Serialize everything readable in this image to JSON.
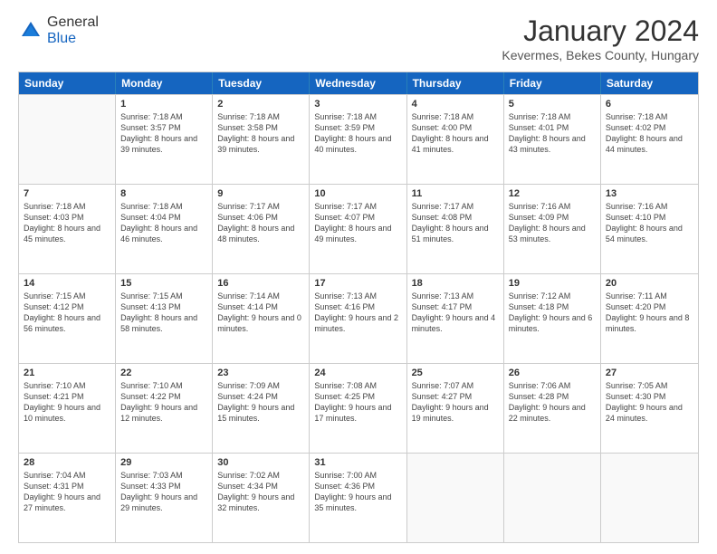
{
  "logo": {
    "general": "General",
    "blue": "Blue"
  },
  "header": {
    "title": "January 2024",
    "subtitle": "Kevermes, Bekes County, Hungary"
  },
  "days": [
    "Sunday",
    "Monday",
    "Tuesday",
    "Wednesday",
    "Thursday",
    "Friday",
    "Saturday"
  ],
  "weeks": [
    [
      {
        "date": "",
        "sunrise": "",
        "sunset": "",
        "daylight": ""
      },
      {
        "date": "1",
        "sunrise": "Sunrise: 7:18 AM",
        "sunset": "Sunset: 3:57 PM",
        "daylight": "Daylight: 8 hours and 39 minutes."
      },
      {
        "date": "2",
        "sunrise": "Sunrise: 7:18 AM",
        "sunset": "Sunset: 3:58 PM",
        "daylight": "Daylight: 8 hours and 39 minutes."
      },
      {
        "date": "3",
        "sunrise": "Sunrise: 7:18 AM",
        "sunset": "Sunset: 3:59 PM",
        "daylight": "Daylight: 8 hours and 40 minutes."
      },
      {
        "date": "4",
        "sunrise": "Sunrise: 7:18 AM",
        "sunset": "Sunset: 4:00 PM",
        "daylight": "Daylight: 8 hours and 41 minutes."
      },
      {
        "date": "5",
        "sunrise": "Sunrise: 7:18 AM",
        "sunset": "Sunset: 4:01 PM",
        "daylight": "Daylight: 8 hours and 43 minutes."
      },
      {
        "date": "6",
        "sunrise": "Sunrise: 7:18 AM",
        "sunset": "Sunset: 4:02 PM",
        "daylight": "Daylight: 8 hours and 44 minutes."
      }
    ],
    [
      {
        "date": "7",
        "sunrise": "Sunrise: 7:18 AM",
        "sunset": "Sunset: 4:03 PM",
        "daylight": "Daylight: 8 hours and 45 minutes."
      },
      {
        "date": "8",
        "sunrise": "Sunrise: 7:18 AM",
        "sunset": "Sunset: 4:04 PM",
        "daylight": "Daylight: 8 hours and 46 minutes."
      },
      {
        "date": "9",
        "sunrise": "Sunrise: 7:17 AM",
        "sunset": "Sunset: 4:06 PM",
        "daylight": "Daylight: 8 hours and 48 minutes."
      },
      {
        "date": "10",
        "sunrise": "Sunrise: 7:17 AM",
        "sunset": "Sunset: 4:07 PM",
        "daylight": "Daylight: 8 hours and 49 minutes."
      },
      {
        "date": "11",
        "sunrise": "Sunrise: 7:17 AM",
        "sunset": "Sunset: 4:08 PM",
        "daylight": "Daylight: 8 hours and 51 minutes."
      },
      {
        "date": "12",
        "sunrise": "Sunrise: 7:16 AM",
        "sunset": "Sunset: 4:09 PM",
        "daylight": "Daylight: 8 hours and 53 minutes."
      },
      {
        "date": "13",
        "sunrise": "Sunrise: 7:16 AM",
        "sunset": "Sunset: 4:10 PM",
        "daylight": "Daylight: 8 hours and 54 minutes."
      }
    ],
    [
      {
        "date": "14",
        "sunrise": "Sunrise: 7:15 AM",
        "sunset": "Sunset: 4:12 PM",
        "daylight": "Daylight: 8 hours and 56 minutes."
      },
      {
        "date": "15",
        "sunrise": "Sunrise: 7:15 AM",
        "sunset": "Sunset: 4:13 PM",
        "daylight": "Daylight: 8 hours and 58 minutes."
      },
      {
        "date": "16",
        "sunrise": "Sunrise: 7:14 AM",
        "sunset": "Sunset: 4:14 PM",
        "daylight": "Daylight: 9 hours and 0 minutes."
      },
      {
        "date": "17",
        "sunrise": "Sunrise: 7:13 AM",
        "sunset": "Sunset: 4:16 PM",
        "daylight": "Daylight: 9 hours and 2 minutes."
      },
      {
        "date": "18",
        "sunrise": "Sunrise: 7:13 AM",
        "sunset": "Sunset: 4:17 PM",
        "daylight": "Daylight: 9 hours and 4 minutes."
      },
      {
        "date": "19",
        "sunrise": "Sunrise: 7:12 AM",
        "sunset": "Sunset: 4:18 PM",
        "daylight": "Daylight: 9 hours and 6 minutes."
      },
      {
        "date": "20",
        "sunrise": "Sunrise: 7:11 AM",
        "sunset": "Sunset: 4:20 PM",
        "daylight": "Daylight: 9 hours and 8 minutes."
      }
    ],
    [
      {
        "date": "21",
        "sunrise": "Sunrise: 7:10 AM",
        "sunset": "Sunset: 4:21 PM",
        "daylight": "Daylight: 9 hours and 10 minutes."
      },
      {
        "date": "22",
        "sunrise": "Sunrise: 7:10 AM",
        "sunset": "Sunset: 4:22 PM",
        "daylight": "Daylight: 9 hours and 12 minutes."
      },
      {
        "date": "23",
        "sunrise": "Sunrise: 7:09 AM",
        "sunset": "Sunset: 4:24 PM",
        "daylight": "Daylight: 9 hours and 15 minutes."
      },
      {
        "date": "24",
        "sunrise": "Sunrise: 7:08 AM",
        "sunset": "Sunset: 4:25 PM",
        "daylight": "Daylight: 9 hours and 17 minutes."
      },
      {
        "date": "25",
        "sunrise": "Sunrise: 7:07 AM",
        "sunset": "Sunset: 4:27 PM",
        "daylight": "Daylight: 9 hours and 19 minutes."
      },
      {
        "date": "26",
        "sunrise": "Sunrise: 7:06 AM",
        "sunset": "Sunset: 4:28 PM",
        "daylight": "Daylight: 9 hours and 22 minutes."
      },
      {
        "date": "27",
        "sunrise": "Sunrise: 7:05 AM",
        "sunset": "Sunset: 4:30 PM",
        "daylight": "Daylight: 9 hours and 24 minutes."
      }
    ],
    [
      {
        "date": "28",
        "sunrise": "Sunrise: 7:04 AM",
        "sunset": "Sunset: 4:31 PM",
        "daylight": "Daylight: 9 hours and 27 minutes."
      },
      {
        "date": "29",
        "sunrise": "Sunrise: 7:03 AM",
        "sunset": "Sunset: 4:33 PM",
        "daylight": "Daylight: 9 hours and 29 minutes."
      },
      {
        "date": "30",
        "sunrise": "Sunrise: 7:02 AM",
        "sunset": "Sunset: 4:34 PM",
        "daylight": "Daylight: 9 hours and 32 minutes."
      },
      {
        "date": "31",
        "sunrise": "Sunrise: 7:00 AM",
        "sunset": "Sunset: 4:36 PM",
        "daylight": "Daylight: 9 hours and 35 minutes."
      },
      {
        "date": "",
        "sunrise": "",
        "sunset": "",
        "daylight": ""
      },
      {
        "date": "",
        "sunrise": "",
        "sunset": "",
        "daylight": ""
      },
      {
        "date": "",
        "sunrise": "",
        "sunset": "",
        "daylight": ""
      }
    ]
  ]
}
